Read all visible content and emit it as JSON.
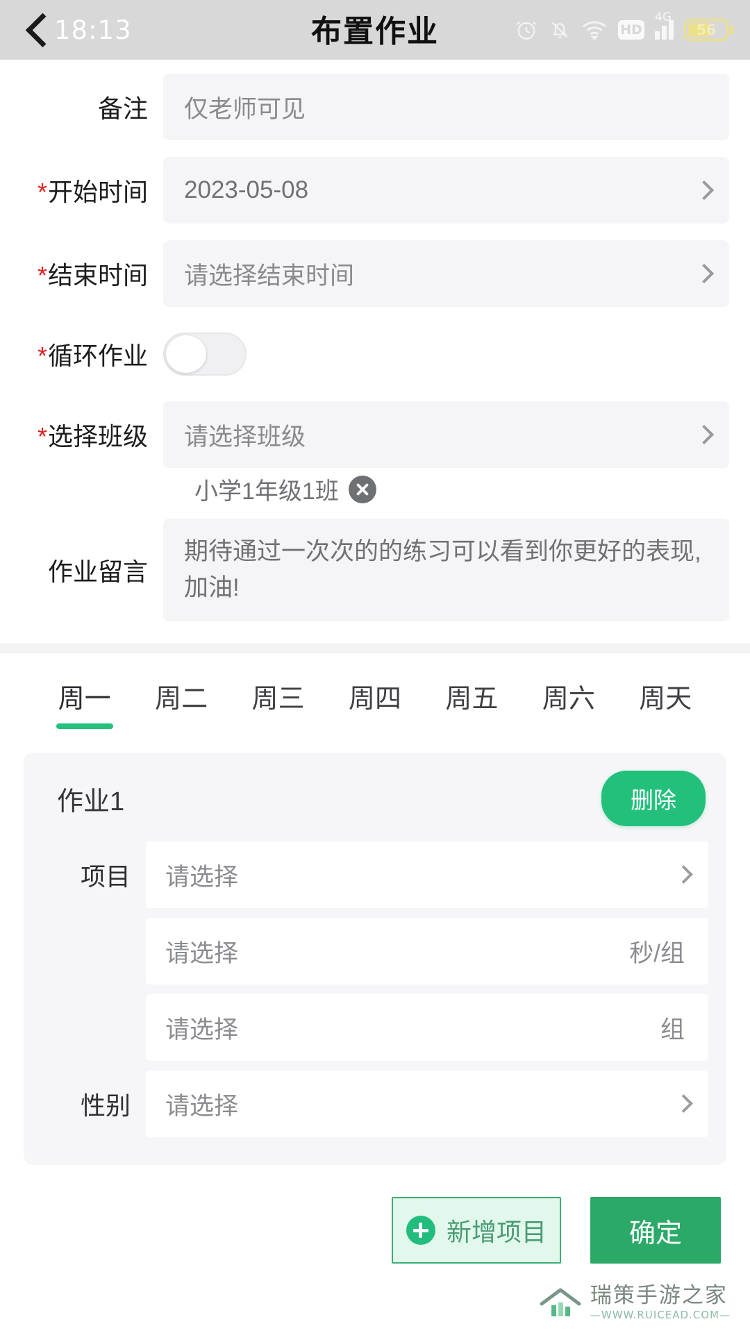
{
  "statusbar": {
    "time": "18:13",
    "icons": [
      "alarm-icon",
      "bell-off-icon",
      "wifi-icon",
      "hd-icon",
      "signal-4g-icon",
      "battery-icon"
    ],
    "hd_label": "HD",
    "network_label": "4G",
    "battery_level": "56"
  },
  "nav": {
    "back_icon": "chevron-left-icon",
    "title": "布置作业"
  },
  "form": {
    "remark": {
      "label": "备注",
      "placeholder": "仅老师可见",
      "value": ""
    },
    "start_time": {
      "label": "开始时间",
      "required": "*",
      "value": "2023-05-08"
    },
    "end_time": {
      "label": "结束时间",
      "required": "*",
      "placeholder": "请选择结束时间",
      "value": ""
    },
    "recurring": {
      "label": "循环作业",
      "required": "*",
      "state": "off"
    },
    "select_class": {
      "label": "选择班级",
      "required": "*",
      "placeholder": "请选择班级",
      "value": ""
    },
    "selected_class_chip": {
      "text": "小学1年级1班",
      "remove_icon": "close-circle-icon"
    },
    "message": {
      "label": "作业留言",
      "value": "期待通过一次次的的练习可以看到你更好的表现,加油!"
    }
  },
  "tabs": {
    "active_index": 0,
    "items": [
      {
        "label": "周一"
      },
      {
        "label": "周二"
      },
      {
        "label": "周三"
      },
      {
        "label": "周四"
      },
      {
        "label": "周五"
      },
      {
        "label": "周六"
      },
      {
        "label": "周天"
      }
    ]
  },
  "homework_card": {
    "title": "作业1",
    "delete_label": "删除",
    "rows": [
      {
        "label": "项目",
        "value": "请选择",
        "unit": "",
        "has_chevron": true
      },
      {
        "label": "",
        "value": "请选择",
        "unit": "秒/组",
        "has_chevron": false
      },
      {
        "label": "",
        "value": "请选择",
        "unit": "组",
        "has_chevron": false
      },
      {
        "label": "性别",
        "value": "请选择",
        "unit": "",
        "has_chevron": true
      }
    ]
  },
  "footer": {
    "add_item_label": "新增项目",
    "add_item_icon": "plus-circle-icon",
    "confirm_label": "确定"
  },
  "watermark": {
    "name": "瑞策手游之家",
    "url": "—WWW.RUICEAD.COM—",
    "logo_icon": "house-logo-icon"
  },
  "colors": {
    "accent_green": "#23c07c",
    "confirm_green": "#2aa968",
    "required_red": "#e02020",
    "field_bg": "#f5f5f7",
    "statusbar_bg": "#d8d8d8",
    "battery_yellow": "#ece08a"
  }
}
